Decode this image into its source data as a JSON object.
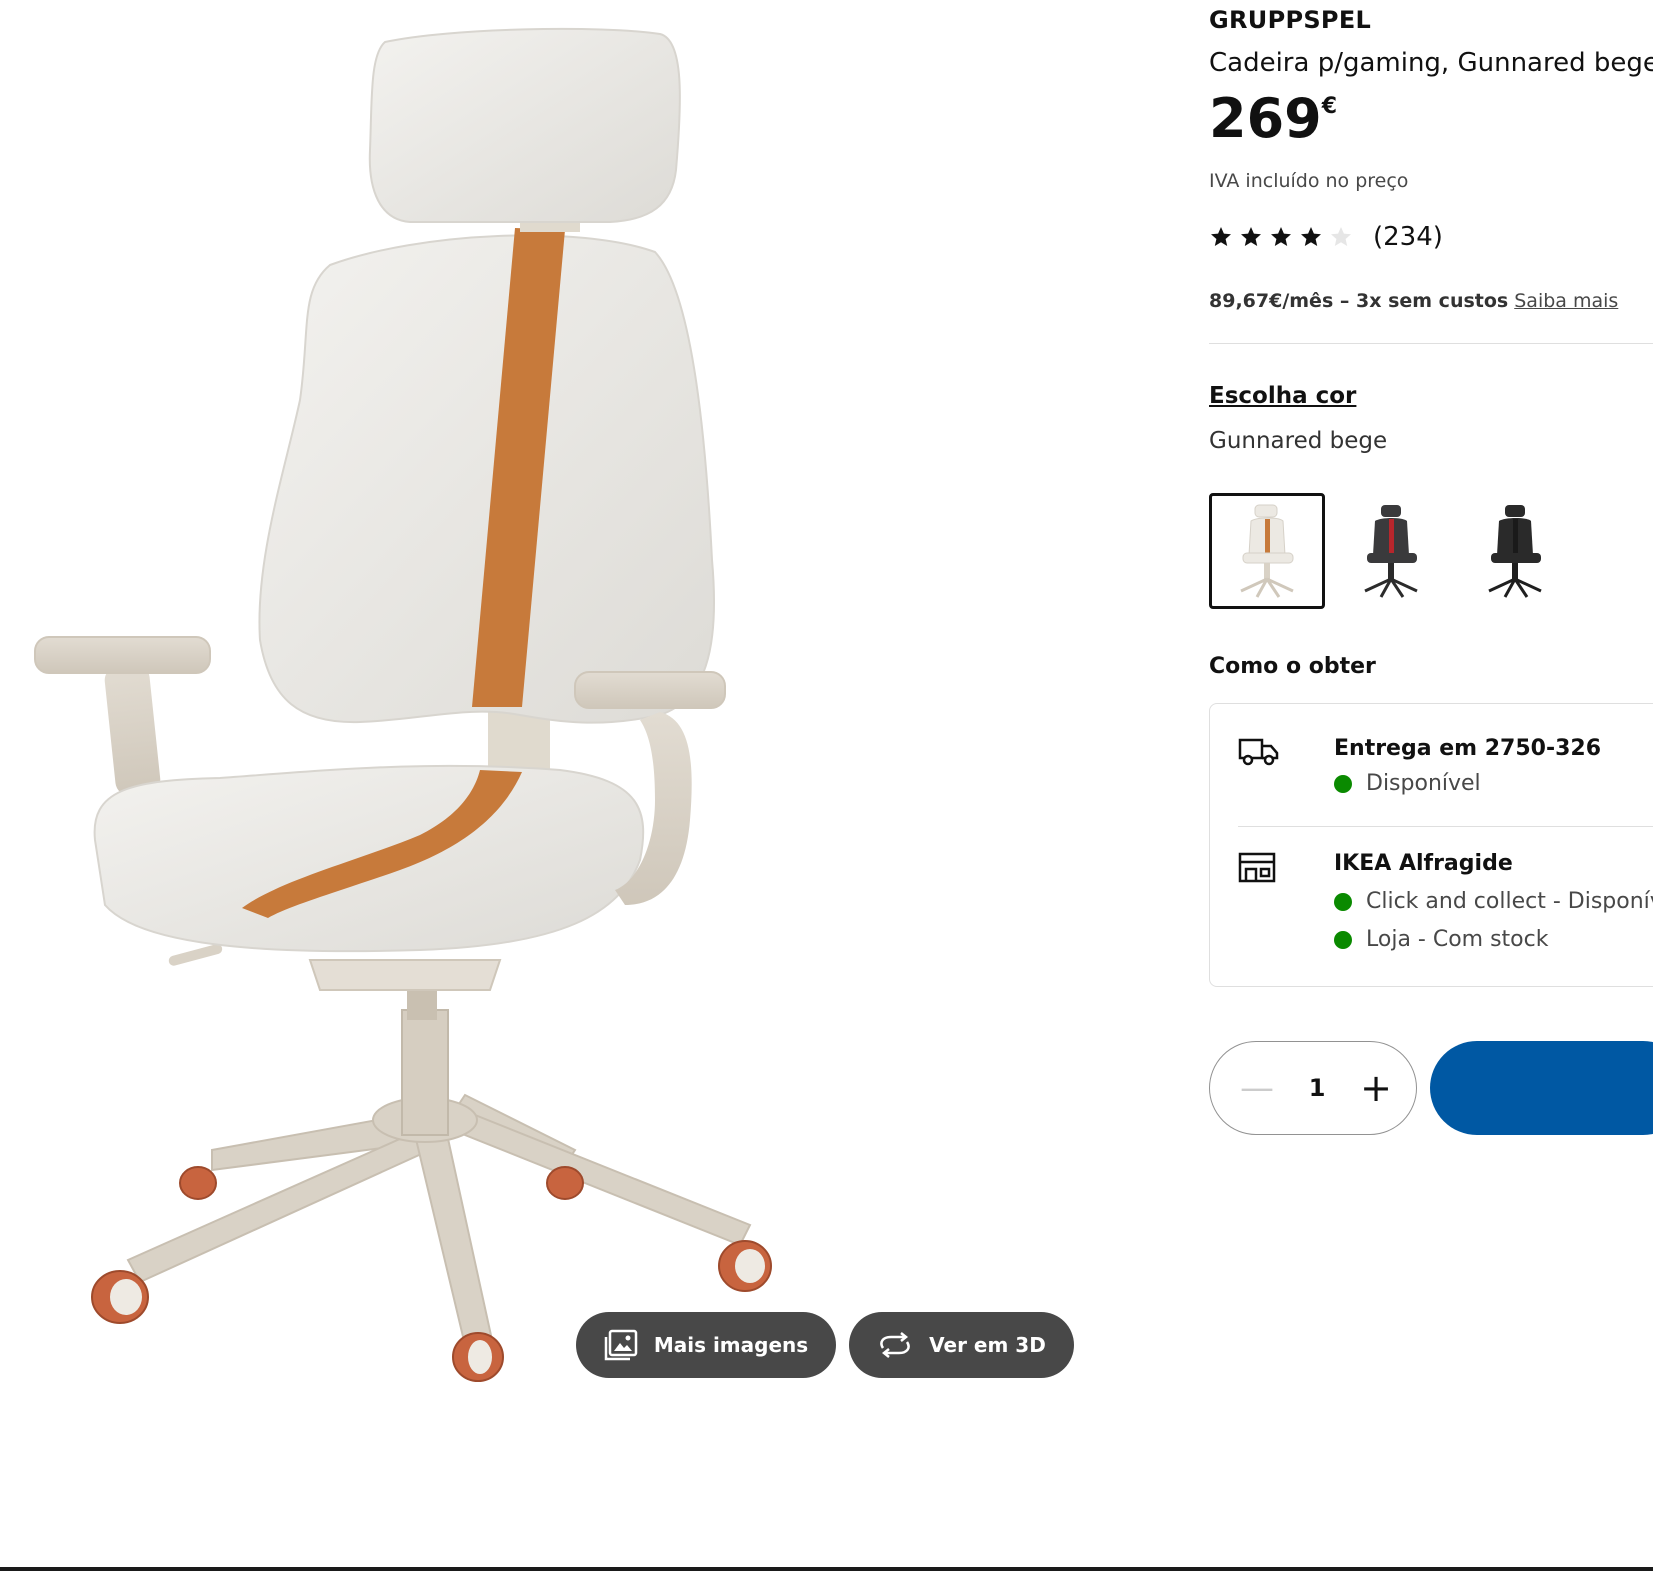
{
  "product": {
    "brand": "GRUPPSPEL",
    "description": "Cadeira p/gaming, Gunnared bege",
    "price_int": "269",
    "price_currency": "€",
    "vat_note": "IVA incluído no preço",
    "rating": {
      "value": 4,
      "max": 5,
      "count": "(234)"
    },
    "installments_text": "89,67€/mês – 3x sem custos",
    "installments_link": "Saiba mais"
  },
  "gallery": {
    "more_images_label": "Mais imagens",
    "more_images_icon": "images-icon",
    "view_3d_label": "Ver em 3D",
    "view_3d_icon": "rotate-3d-icon"
  },
  "color": {
    "choose_label": "Escolha cor",
    "selected_name": "Gunnared bege",
    "swatches": [
      {
        "name": "beige",
        "selected": true
      },
      {
        "name": "dark-red",
        "selected": false
      },
      {
        "name": "black",
        "selected": false
      }
    ]
  },
  "fulfillment": {
    "title": "Como o obter",
    "delivery": {
      "title": "Entrega em 2750-326",
      "status": "Disponível",
      "icon": "truck-icon"
    },
    "store": {
      "title": "IKEA Alfragide",
      "icon": "store-icon",
      "statuses": [
        "Click and collect - Disponível",
        "Loja - Com stock"
      ]
    },
    "status_color": "#0a8a00"
  },
  "cart": {
    "quantity": "1",
    "minus_label": "—",
    "plus_label": "+",
    "accent": "#0058a3"
  }
}
